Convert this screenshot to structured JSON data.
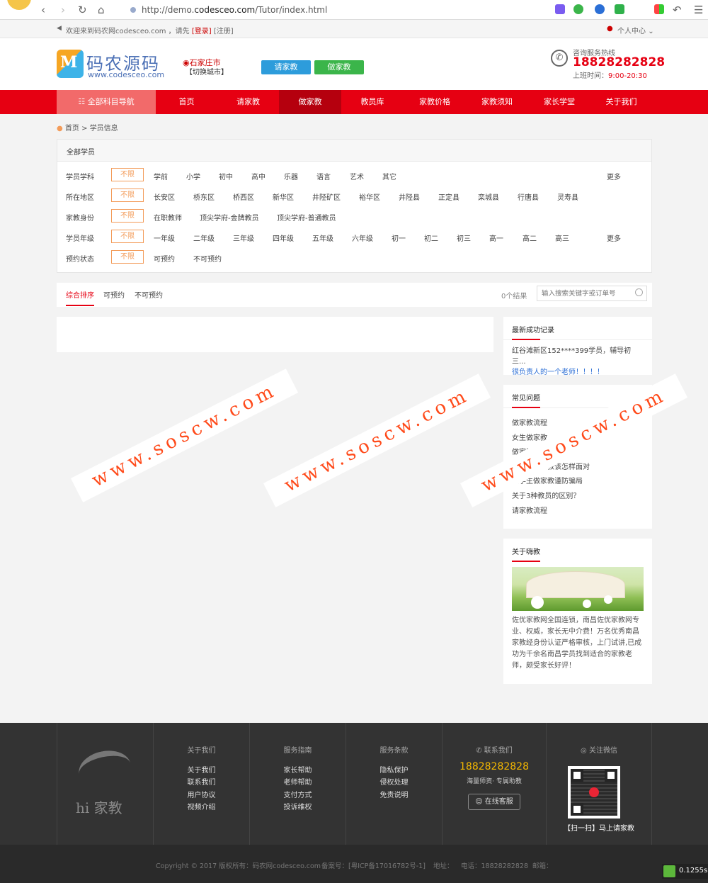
{
  "browser": {
    "url_prefix": "http://demo.",
    "url_host": "codesceo.com",
    "url_path": "/Tutor/index.html"
  },
  "topbar": {
    "welcome": "欢迎来到码农网codesceo.com ，请先",
    "login": "[登录]",
    "register": "[注册]",
    "user_center": "个人中心"
  },
  "header": {
    "logo_letter": "M",
    "logo_title": "码农源码",
    "logo_url": "www.codesceo.com",
    "city": "石家庄市",
    "switch_city": "【切换城市】",
    "btn_request": "请家教",
    "btn_tutor": "做家教",
    "hotline_label": "咨询服务热线",
    "hotline": "18828282828",
    "hours_label": "上班时间：",
    "hours": "9:00-20:30"
  },
  "nav": [
    {
      "label": "全部科目导航"
    },
    {
      "label": "首页"
    },
    {
      "label": "请家教"
    },
    {
      "label": "做家教"
    },
    {
      "label": "教员库"
    },
    {
      "label": "家教价格"
    },
    {
      "label": "家教须知"
    },
    {
      "label": "家长学堂"
    },
    {
      "label": "关于我们"
    }
  ],
  "breadcrumb": {
    "home": "首页",
    "sep": ">",
    "current": "学员信息"
  },
  "filter": {
    "title": "全部学员",
    "nolimit": "不限",
    "more": "更多",
    "rows": [
      {
        "label": "学员学科",
        "options": [
          "学前",
          "小学",
          "初中",
          "高中",
          "乐器",
          "语言",
          "艺术",
          "其它"
        ]
      },
      {
        "label": "所在地区",
        "options": [
          "长安区",
          "桥东区",
          "桥西区",
          "新华区",
          "井陉矿区",
          "裕华区",
          "井陉县",
          "正定县",
          "栾城县",
          "行唐县",
          "灵寿县"
        ]
      },
      {
        "label": "家教身份",
        "options": [
          "在职教师",
          "顶尖学府-金牌教员",
          "顶尖学府-普通教员"
        ]
      },
      {
        "label": "学员年级",
        "options": [
          "一年级",
          "二年级",
          "三年级",
          "四年级",
          "五年级",
          "六年级",
          "初一",
          "初二",
          "初三",
          "高一",
          "高二",
          "高三"
        ]
      },
      {
        "label": "预约状态",
        "options": [
          "可预约",
          "不可预约"
        ]
      }
    ]
  },
  "sortbar": {
    "tabs": [
      "综合排序",
      "可预约",
      "不可预约"
    ],
    "result": "0个结果",
    "search_placeholder": "输入搜索关键字或订单号"
  },
  "sidebar": {
    "records_title": "最新成功记录",
    "record_line1": "红谷滩新区152****399学员，辅导初三...",
    "record_line2": "很负责人的一个老师！！！！",
    "faq_title": "常见问题",
    "faq": [
      "做家教流程",
      "女生做家教",
      "做家教注意问题",
      "大学生做家教该怎样面对",
      "大学生做家教谨防骗局",
      "关于3种教员的区别？",
      "请家教流程"
    ],
    "about_title": "关于嗨教",
    "about_text": "佐优家教网全国连锁，南昌佐优家教网专业、权威，家长无中介费！万名优秀南昌家教经身份认证严格审核，上门试讲,已成功为千余名南昌学员找到适合的家教老师，颇受家长好评！"
  },
  "watermark": "www.soscw.com",
  "footer": {
    "brand": "hi 家教",
    "col_about": {
      "title": "关于我们",
      "links": [
        "关于我们",
        "联系我们",
        "用户协议",
        "视频介绍"
      ]
    },
    "col_guide": {
      "title": "服务指南",
      "links": [
        "家长帮助",
        "老师帮助",
        "支付方式",
        "投诉维权"
      ]
    },
    "col_terms": {
      "title": "服务条款",
      "links": [
        "隐私保护",
        "侵权处理",
        "免责说明"
      ]
    },
    "contact_title": "联系我们",
    "contact_phone": "18828282828",
    "contact_slogan": "海量师资· 专属助教",
    "online_service": "在线客服",
    "wechat_title": "关注微信",
    "wechat_caption": "【扫一扫】马上请家教",
    "copyright": "Copyright © 2017 版权所有：码农网codesceo.com",
    "icp": "备案号：[粤ICP备17016782号-1]",
    "address": "地址：",
    "tel": "电话：18828282828",
    "email": "邮箱：",
    "timer": "0.1255s"
  },
  "colors": {
    "brand_red": "#e60012",
    "orange": "#f39c5a",
    "blue": "#2d9cdb",
    "green": "#3bb54a",
    "footer": "#333333"
  }
}
